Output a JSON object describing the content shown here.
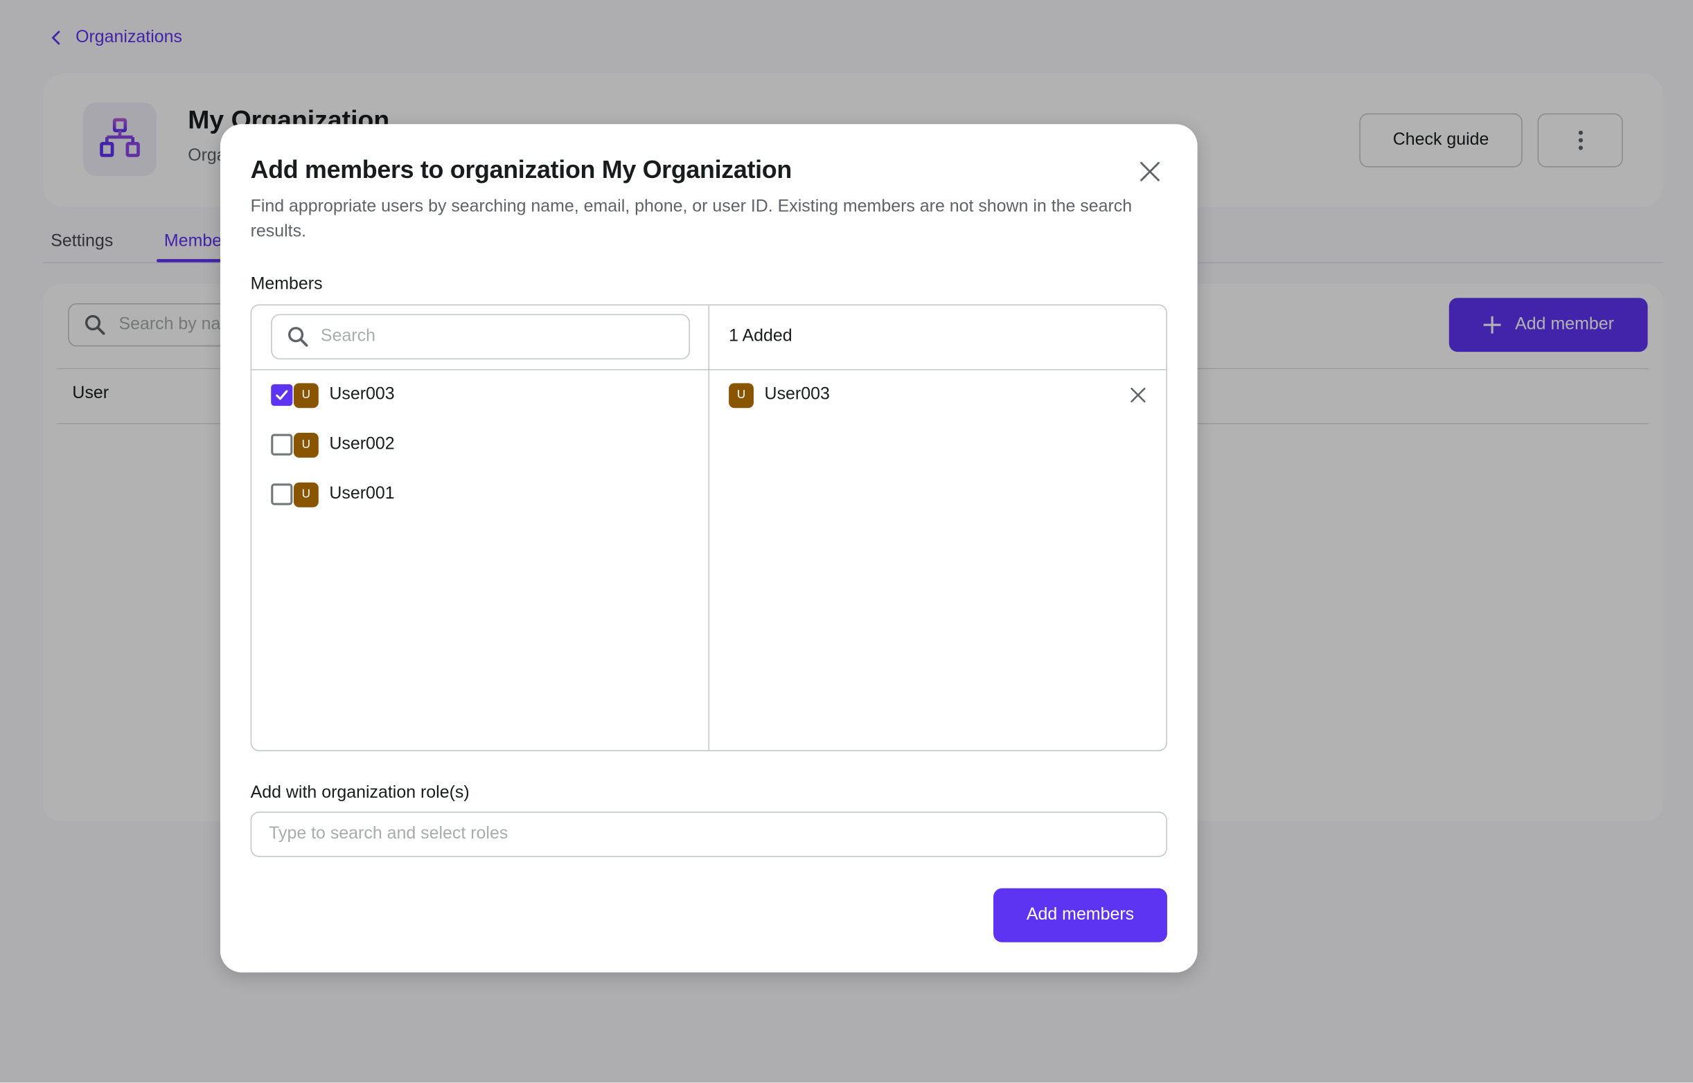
{
  "page": {
    "back_link": "Organizations",
    "org": {
      "name": "My Organization",
      "subtitle": "Organization"
    },
    "header_buttons": {
      "check_guide": "Check guide",
      "more_icon": "more-vertical-icon"
    },
    "tabs": [
      {
        "label": "Settings",
        "active": false
      },
      {
        "label": "Members",
        "active": true
      }
    ],
    "members_panel": {
      "search_placeholder": "Search by name",
      "add_member_label": "Add member",
      "table_headers": [
        "User"
      ]
    }
  },
  "modal": {
    "title": "Add members to organization My Organization",
    "description": "Find appropriate users by searching name, email, phone, or user ID. Existing members are not shown in the search results.",
    "members_label": "Members",
    "search_placeholder": "Search",
    "search_value": "",
    "available_users": [
      {
        "name": "User003",
        "avatar_letter": "U",
        "checked": true
      },
      {
        "name": "User002",
        "avatar_letter": "U",
        "checked": false
      },
      {
        "name": "User001",
        "avatar_letter": "U",
        "checked": false
      }
    ],
    "added_count_label": "1 Added",
    "added_users": [
      {
        "name": "User003",
        "avatar_letter": "U"
      }
    ],
    "roles_label": "Add with organization role(s)",
    "roles_placeholder": "Type to search and select roles",
    "roles_value": "",
    "submit_label": "Add members"
  },
  "colors": {
    "primary": "#5d34f2",
    "avatar": "#8a5500",
    "overlay": "rgba(0,0,0,0.30)"
  }
}
